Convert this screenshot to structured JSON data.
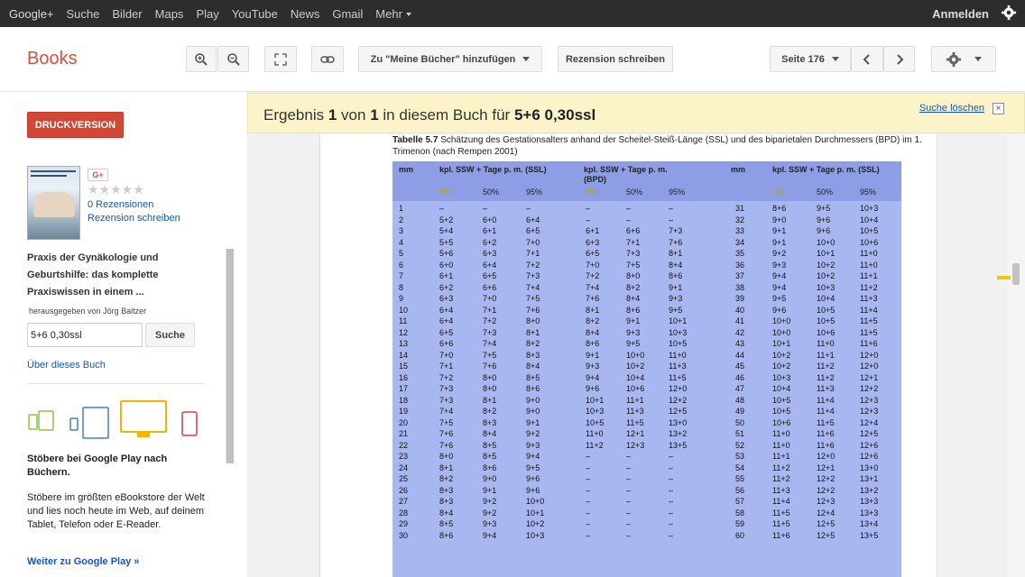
{
  "topbar": {
    "nav": [
      "Google+",
      "Suche",
      "Bilder",
      "Maps",
      "Play",
      "YouTube",
      "News",
      "Gmail"
    ],
    "more": "Mehr",
    "signin": "Anmelden",
    "settings_icon": "gear-icon"
  },
  "header": {
    "logo": "Books",
    "zoom_in_icon": "zoom-in-icon",
    "zoom_out_icon": "zoom-out-icon",
    "fullscreen_icon": "fullscreen-icon",
    "link_icon": "link-icon",
    "add_to_library": "Zu \"Meine Bücher\" hinzufügen",
    "write_review": "Rezension schreiben",
    "page_select": "Seite 176",
    "prev_icon": "chevron-left-icon",
    "next_icon": "chevron-right-icon",
    "settings_icon": "gear-icon"
  },
  "sidebar": {
    "print": "DRUCKVERSION",
    "gplus": "G+",
    "stars": "★★★★★",
    "reviews": "0 Rezensionen",
    "write_review": "Rezension schreiben",
    "title": "Praxis der Gynäkologie und Geburtshilfe: das komplette Praxiswissen in einem ...",
    "editor": "herausgegeben von Jörg Baltzer",
    "search_value": "5+6 0,30ssl",
    "search_btn": "Suche",
    "about": "Über dieses Buch",
    "play_title": "Stöbere bei Google Play nach Büchern.",
    "play_desc": "Stöbere im größten eBookstore der Welt und lies noch heute im Web, auf deinem Tablet, Telefon oder E-Reader.",
    "play_link": "Weiter zu Google Play »"
  },
  "result": {
    "prefix": "Ergebnis",
    "num": "1",
    "mid": "von",
    "total": "1",
    "suffix": "in diesem Buch für",
    "query": "5+6 0,30ssl",
    "clear": "Suche löschen",
    "close": "×"
  },
  "page": {
    "caption_label": "Tabelle 5.7",
    "caption": "Schätzung des Gestationsalters anhand der Scheitel-Steiß-Länge (SSL) und des biparietalen Durchmessers (BPD) im 1. Trimenon (nach Rempen 2001)",
    "headers": {
      "mm1": "mm",
      "ssl_title": "kpl. SSW + Tage p. m. (SSL)",
      "bpd_title": "kpl. SSW + Tage p. m. (BPD)",
      "mm2": "mm",
      "ssl2_title": "kpl. SSW + Tage p. m. (SSL)",
      "p5": "5%",
      "p50": "50%",
      "p95": "95%"
    },
    "rows": [
      [
        "1",
        "–",
        "–",
        "–",
        "–",
        "–",
        "–",
        "31",
        "8+6",
        "9+5",
        "10+3"
      ],
      [
        "2",
        "5+2",
        "6+0",
        "6+4",
        "–",
        "–",
        "–",
        "32",
        "9+0",
        "9+6",
        "10+4"
      ],
      [
        "3",
        "5+4",
        "6+1",
        "6+5",
        "6+1",
        "6+6",
        "7+3",
        "33",
        "9+1",
        "9+6",
        "10+5"
      ],
      [
        "4",
        "5+5",
        "6+2",
        "7+0",
        "6+3",
        "7+1",
        "7+6",
        "34",
        "9+1",
        "10+0",
        "10+6"
      ],
      [
        "5",
        "5+6",
        "6+3",
        "7+1",
        "6+5",
        "7+3",
        "8+1",
        "35",
        "9+2",
        "10+1",
        "11+0"
      ],
      [
        "6",
        "6+0",
        "6+4",
        "7+2",
        "7+0",
        "7+5",
        "8+4",
        "36",
        "9+3",
        "10+2",
        "11+0"
      ],
      [
        "7",
        "6+1",
        "6+5",
        "7+3",
        "7+2",
        "8+0",
        "8+6",
        "37",
        "9+4",
        "10+2",
        "11+1"
      ],
      [
        "8",
        "6+2",
        "6+6",
        "7+4",
        "7+4",
        "8+2",
        "9+1",
        "38",
        "9+4",
        "10+3",
        "11+2"
      ],
      [
        "9",
        "6+3",
        "7+0",
        "7+5",
        "7+6",
        "8+4",
        "9+3",
        "39",
        "9+5",
        "10+4",
        "11+3"
      ],
      [
        "10",
        "6+4",
        "7+1",
        "7+6",
        "8+1",
        "8+6",
        "9+5",
        "40",
        "9+6",
        "10+5",
        "11+4"
      ],
      [
        "11",
        "6+4",
        "7+2",
        "8+0",
        "8+2",
        "9+1",
        "10+1",
        "41",
        "10+0",
        "10+5",
        "11+5"
      ],
      [
        "12",
        "6+5",
        "7+3",
        "8+1",
        "8+4",
        "9+3",
        "10+3",
        "42",
        "10+0",
        "10+6",
        "11+5"
      ],
      [
        "13",
        "6+6",
        "7+4",
        "8+2",
        "8+6",
        "9+5",
        "10+5",
        "43",
        "10+1",
        "11+0",
        "11+6"
      ],
      [
        "14",
        "7+0",
        "7+5",
        "8+3",
        "9+1",
        "10+0",
        "11+0",
        "44",
        "10+2",
        "11+1",
        "12+0"
      ],
      [
        "15",
        "7+1",
        "7+6",
        "8+4",
        "9+3",
        "10+2",
        "11+3",
        "45",
        "10+2",
        "11+2",
        "12+0"
      ],
      [
        "16",
        "7+2",
        "8+0",
        "8+5",
        "9+4",
        "10+4",
        "11+5",
        "46",
        "10+3",
        "11+2",
        "12+1"
      ],
      [
        "17",
        "7+3",
        "8+0",
        "8+6",
        "9+6",
        "10+6",
        "12+0",
        "47",
        "10+4",
        "11+3",
        "12+2"
      ],
      [
        "18",
        "7+3",
        "8+1",
        "9+0",
        "10+1",
        "11+1",
        "12+2",
        "48",
        "10+5",
        "11+4",
        "12+3"
      ],
      [
        "19",
        "7+4",
        "8+2",
        "9+0",
        "10+3",
        "11+3",
        "12+5",
        "49",
        "10+5",
        "11+4",
        "12+3"
      ],
      [
        "20",
        "7+5",
        "8+3",
        "9+1",
        "10+5",
        "11+5",
        "13+0",
        "50",
        "10+6",
        "11+5",
        "12+4"
      ],
      [
        "21",
        "7+6",
        "8+4",
        "9+2",
        "11+0",
        "12+1",
        "13+2",
        "51",
        "11+0",
        "11+6",
        "12+5"
      ],
      [
        "22",
        "7+6",
        "8+5",
        "9+3",
        "11+2",
        "12+3",
        "13+5",
        "52",
        "11+0",
        "11+6",
        "12+6"
      ],
      [
        "23",
        "8+0",
        "8+5",
        "9+4",
        "–",
        "–",
        "–",
        "53",
        "11+1",
        "12+0",
        "12+6"
      ],
      [
        "24",
        "8+1",
        "8+6",
        "9+5",
        "–",
        "–",
        "–",
        "54",
        "11+2",
        "12+1",
        "13+0"
      ],
      [
        "25",
        "8+2",
        "9+0",
        "9+6",
        "–",
        "–",
        "–",
        "55",
        "11+2",
        "12+2",
        "13+1"
      ],
      [
        "26",
        "8+3",
        "9+1",
        "9+6",
        "–",
        "–",
        "–",
        "56",
        "11+3",
        "12+2",
        "13+2"
      ],
      [
        "27",
        "8+3",
        "9+2",
        "10+0",
        "–",
        "–",
        "–",
        "57",
        "11+4",
        "12+3",
        "13+3"
      ],
      [
        "28",
        "8+4",
        "9+2",
        "10+1",
        "–",
        "–",
        "–",
        "58",
        "11+5",
        "12+4",
        "13+3"
      ],
      [
        "29",
        "8+5",
        "9+3",
        "10+2",
        "–",
        "–",
        "–",
        "59",
        "11+5",
        "12+5",
        "13+4"
      ],
      [
        "30",
        "8+6",
        "9+4",
        "10+3",
        "–",
        "–",
        "–",
        "60",
        "11+6",
        "12+5",
        "13+5"
      ]
    ]
  }
}
